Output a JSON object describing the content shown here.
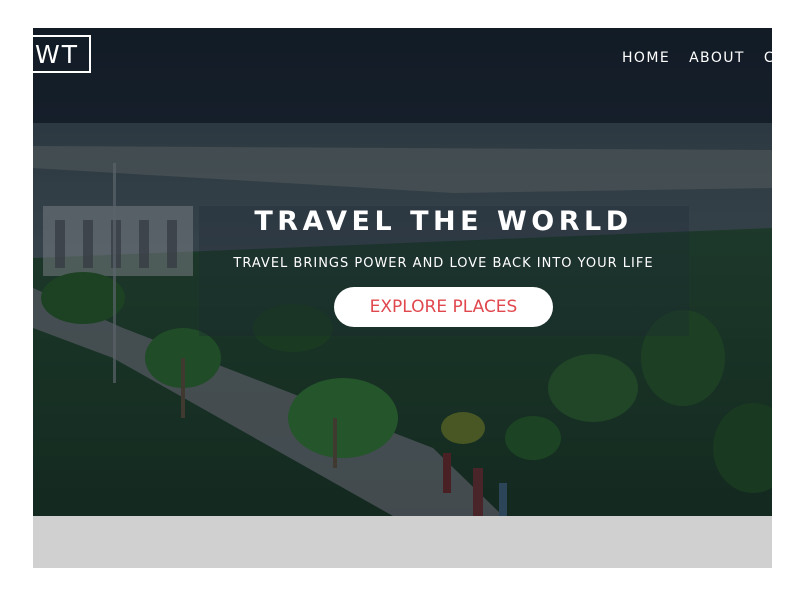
{
  "header": {
    "logo_text": "WT",
    "nav": [
      {
        "label": "HOME"
      },
      {
        "label": "ABOUT"
      },
      {
        "label": "C"
      }
    ]
  },
  "hero": {
    "title": "TRAVEL THE WORLD",
    "subtitle": "TRAVEL BRINGS POWER AND LOVE BACK INTO YOUR LIFE",
    "cta_label": "EXPLORE PLACES"
  },
  "colors": {
    "accent": "#e0484e",
    "nav_text": "#ffffff",
    "below_fold": "#d0d0d0"
  }
}
